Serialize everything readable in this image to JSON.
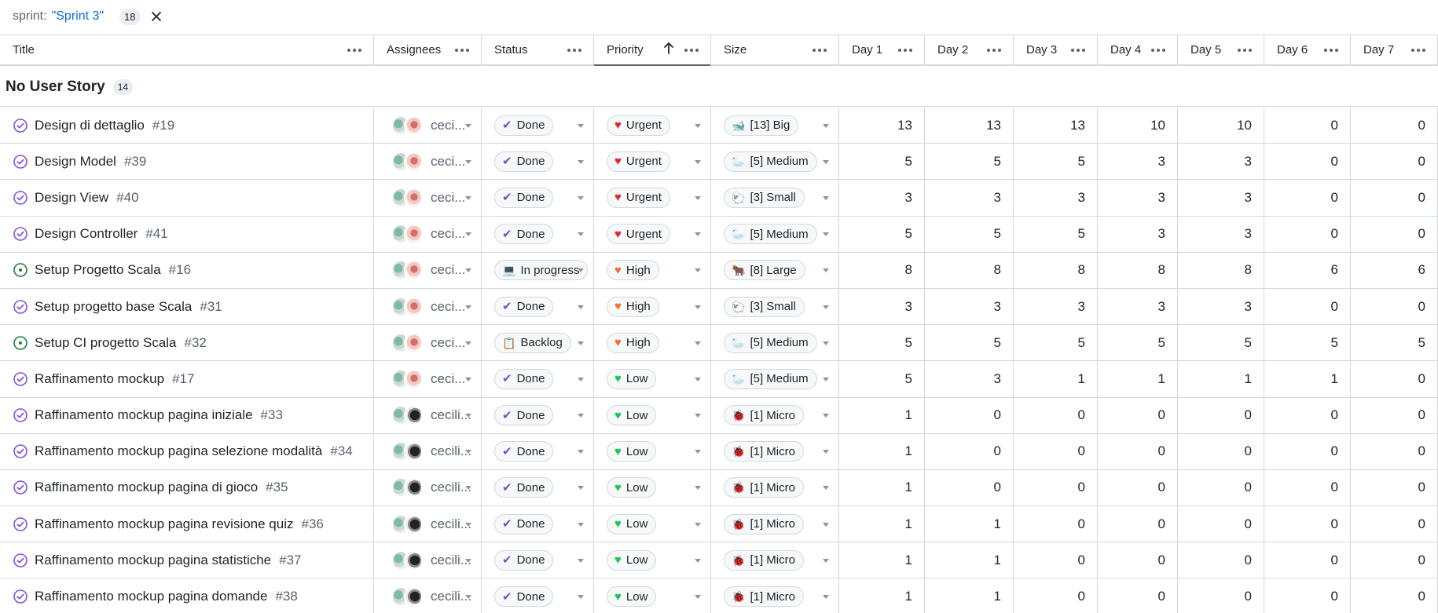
{
  "filter": {
    "key": "sprint:",
    "value": "\"Sprint 3\"",
    "count": "18"
  },
  "columns": [
    {
      "label": "Title",
      "width": 476
    },
    {
      "label": "Assignees",
      "width": 137
    },
    {
      "label": "Status",
      "width": 143
    },
    {
      "label": "Priority",
      "width": 149,
      "sorted": true
    },
    {
      "label": "Size",
      "width": 163
    },
    {
      "label": "Day 1",
      "width": 109
    },
    {
      "label": "Day 2",
      "width": 113
    },
    {
      "label": "Day 3",
      "width": 107
    },
    {
      "label": "Day 4",
      "width": 102
    },
    {
      "label": "Day 5",
      "width": 110
    },
    {
      "label": "Day 6",
      "width": 110
    },
    {
      "label": "Day 7",
      "width": 111
    }
  ],
  "group": {
    "title": "No User Story",
    "count": "14"
  },
  "colors": {
    "done": "#8250df",
    "open": "#1a7f37",
    "urgent": "#e5262d",
    "high": "#f0732a",
    "low": "#21c35b",
    "accent": "#0969da"
  },
  "rows": [
    {
      "title": "Design di dettaglio",
      "num": "#19",
      "state": "done",
      "assignee": "ceci...",
      "avatar2": "red",
      "status": "Done",
      "status_icon": "check-icon",
      "priority": "Urgent",
      "size": "[13] Big",
      "size_icon": "whale-icon",
      "days": [
        "13",
        "13",
        "13",
        "10",
        "10",
        "0",
        "0"
      ]
    },
    {
      "title": "Design Model",
      "num": "#39",
      "state": "done",
      "assignee": "ceci...",
      "avatar2": "red",
      "status": "Done",
      "status_icon": "check-icon",
      "priority": "Urgent",
      "size": "[5] Medium",
      "size_icon": "goose-icon",
      "days": [
        "5",
        "5",
        "5",
        "3",
        "3",
        "0",
        "0"
      ]
    },
    {
      "title": "Design View",
      "num": "#40",
      "state": "done",
      "assignee": "ceci...",
      "avatar2": "red",
      "status": "Done",
      "status_icon": "check-icon",
      "priority": "Urgent",
      "size": "[3] Small",
      "size_icon": "sheep-icon",
      "days": [
        "3",
        "3",
        "3",
        "3",
        "3",
        "0",
        "0"
      ]
    },
    {
      "title": "Design Controller",
      "num": "#41",
      "state": "done",
      "assignee": "ceci...",
      "avatar2": "red",
      "status": "Done",
      "status_icon": "check-icon",
      "priority": "Urgent",
      "size": "[5] Medium",
      "size_icon": "goose-icon",
      "days": [
        "5",
        "5",
        "5",
        "3",
        "3",
        "0",
        "0"
      ]
    },
    {
      "title": "Setup Progetto Scala",
      "num": "#16",
      "state": "open",
      "assignee": "ceci...",
      "avatar2": "red",
      "status": "In progress",
      "status_icon": "laptop-icon",
      "priority": "High",
      "size": "[8] Large",
      "size_icon": "ox-icon",
      "days": [
        "8",
        "8",
        "8",
        "8",
        "8",
        "6",
        "6"
      ]
    },
    {
      "title": "Setup progetto base Scala",
      "num": "#31",
      "state": "done",
      "assignee": "ceci...",
      "avatar2": "red",
      "status": "Done",
      "status_icon": "check-icon",
      "priority": "High",
      "size": "[3] Small",
      "size_icon": "sheep-icon",
      "days": [
        "3",
        "3",
        "3",
        "3",
        "3",
        "0",
        "0"
      ]
    },
    {
      "title": "Setup CI progetto Scala",
      "num": "#32",
      "state": "open",
      "assignee": "ceci...",
      "avatar2": "red",
      "status": "Backlog",
      "status_icon": "clipboard-icon",
      "priority": "High",
      "size": "[5] Medium",
      "size_icon": "goose-icon",
      "days": [
        "5",
        "5",
        "5",
        "5",
        "5",
        "5",
        "5"
      ]
    },
    {
      "title": "Raffinamento mockup",
      "num": "#17",
      "state": "done",
      "assignee": "ceci...",
      "avatar2": "red",
      "status": "Done",
      "status_icon": "check-icon",
      "priority": "Low",
      "size": "[5] Medium",
      "size_icon": "goose-icon",
      "days": [
        "5",
        "3",
        "1",
        "1",
        "1",
        "1",
        "0"
      ]
    },
    {
      "title": "Raffinamento mockup pagina iniziale",
      "num": "#33",
      "state": "done",
      "assignee": "cecili...",
      "avatar2": "dark",
      "status": "Done",
      "status_icon": "check-icon",
      "priority": "Low",
      "size": "[1] Micro",
      "size_icon": "ladybug-icon",
      "days": [
        "1",
        "0",
        "0",
        "0",
        "0",
        "0",
        "0"
      ]
    },
    {
      "title": "Raffinamento mockup pagina selezione modalità",
      "num": "#34",
      "state": "done",
      "assignee": "cecili...",
      "avatar2": "dark",
      "status": "Done",
      "status_icon": "check-icon",
      "priority": "Low",
      "size": "[1] Micro",
      "size_icon": "ladybug-icon",
      "days": [
        "1",
        "0",
        "0",
        "0",
        "0",
        "0",
        "0"
      ]
    },
    {
      "title": "Raffinamento mockup pagina di gioco",
      "num": "#35",
      "state": "done",
      "assignee": "cecili...",
      "avatar2": "dark",
      "status": "Done",
      "status_icon": "check-icon",
      "priority": "Low",
      "size": "[1] Micro",
      "size_icon": "ladybug-icon",
      "days": [
        "1",
        "0",
        "0",
        "0",
        "0",
        "0",
        "0"
      ]
    },
    {
      "title": "Raffinamento mockup pagina revisione quiz",
      "num": "#36",
      "state": "done",
      "assignee": "cecili...",
      "avatar2": "dark",
      "status": "Done",
      "status_icon": "check-icon",
      "priority": "Low",
      "size": "[1] Micro",
      "size_icon": "ladybug-icon",
      "days": [
        "1",
        "1",
        "0",
        "0",
        "0",
        "0",
        "0"
      ]
    },
    {
      "title": "Raffinamento mockup pagina statistiche",
      "num": "#37",
      "state": "done",
      "assignee": "cecili...",
      "avatar2": "dark",
      "status": "Done",
      "status_icon": "check-icon",
      "priority": "Low",
      "size": "[1] Micro",
      "size_icon": "ladybug-icon",
      "days": [
        "1",
        "1",
        "0",
        "0",
        "0",
        "0",
        "0"
      ]
    },
    {
      "title": "Raffinamento mockup pagina domande",
      "num": "#38",
      "state": "done",
      "assignee": "cecili...",
      "avatar2": "dark",
      "status": "Done",
      "status_icon": "check-icon",
      "priority": "Low",
      "size": "[1] Micro",
      "size_icon": "ladybug-icon",
      "days": [
        "1",
        "1",
        "0",
        "0",
        "0",
        "0",
        "0"
      ]
    }
  ]
}
